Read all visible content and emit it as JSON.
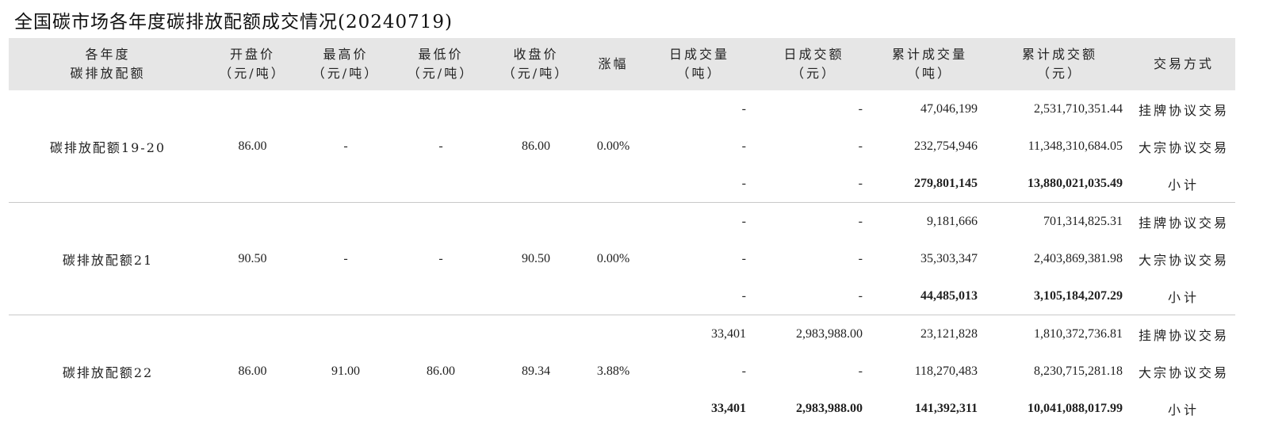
{
  "title": "全国碳市场各年度碳排放配额成交情况(20240719)",
  "headers": {
    "product": [
      "各年度",
      "碳排放配额"
    ],
    "open": [
      "开盘价",
      "（元/吨）"
    ],
    "high": [
      "最高价",
      "（元/吨）"
    ],
    "low": [
      "最低价",
      "（元/吨）"
    ],
    "close": [
      "收盘价",
      "（元/吨）"
    ],
    "change": [
      "涨幅"
    ],
    "day_volume": [
      "日成交量",
      "（吨）"
    ],
    "day_amount": [
      "日成交额",
      "（元）"
    ],
    "cum_volume": [
      "累计成交量",
      "（吨）"
    ],
    "cum_amount": [
      "累计成交额",
      "（元）"
    ],
    "method": [
      "交易方式"
    ]
  },
  "groups": [
    {
      "product": "碳排放配额19-20",
      "open": "86.00",
      "high": "-",
      "low": "-",
      "close": "86.00",
      "change": "0.00%",
      "rows": [
        {
          "day_volume": "-",
          "day_amount": "-",
          "cum_volume": "47,046,199",
          "cum_amount": "2,531,710,351.44",
          "method": "挂牌协议交易"
        },
        {
          "day_volume": "-",
          "day_amount": "-",
          "cum_volume": "232,754,946",
          "cum_amount": "11,348,310,684.05",
          "method": "大宗协议交易"
        },
        {
          "day_volume": "-",
          "day_amount": "-",
          "cum_volume": "279,801,145",
          "cum_amount": "13,880,021,035.49",
          "method": "小计"
        }
      ]
    },
    {
      "product": "碳排放配额21",
      "open": "90.50",
      "high": "-",
      "low": "-",
      "close": "90.50",
      "change": "0.00%",
      "rows": [
        {
          "day_volume": "-",
          "day_amount": "-",
          "cum_volume": "9,181,666",
          "cum_amount": "701,314,825.31",
          "method": "挂牌协议交易"
        },
        {
          "day_volume": "-",
          "day_amount": "-",
          "cum_volume": "35,303,347",
          "cum_amount": "2,403,869,381.98",
          "method": "大宗协议交易"
        },
        {
          "day_volume": "-",
          "day_amount": "-",
          "cum_volume": "44,485,013",
          "cum_amount": "3,105,184,207.29",
          "method": "小计"
        }
      ]
    },
    {
      "product": "碳排放配额22",
      "open": "86.00",
      "high": "91.00",
      "low": "86.00",
      "close": "89.34",
      "change": "3.88%",
      "rows": [
        {
          "day_volume": "33,401",
          "day_amount": "2,983,988.00",
          "cum_volume": "23,121,828",
          "cum_amount": "1,810,372,736.81",
          "method": "挂牌协议交易"
        },
        {
          "day_volume": "-",
          "day_amount": "-",
          "cum_volume": "118,270,483",
          "cum_amount": "8,230,715,281.18",
          "method": "大宗协议交易"
        },
        {
          "day_volume": "33,401",
          "day_amount": "2,983,988.00",
          "cum_volume": "141,392,311",
          "cum_amount": "10,041,088,017.99",
          "method": "小计"
        }
      ]
    }
  ]
}
